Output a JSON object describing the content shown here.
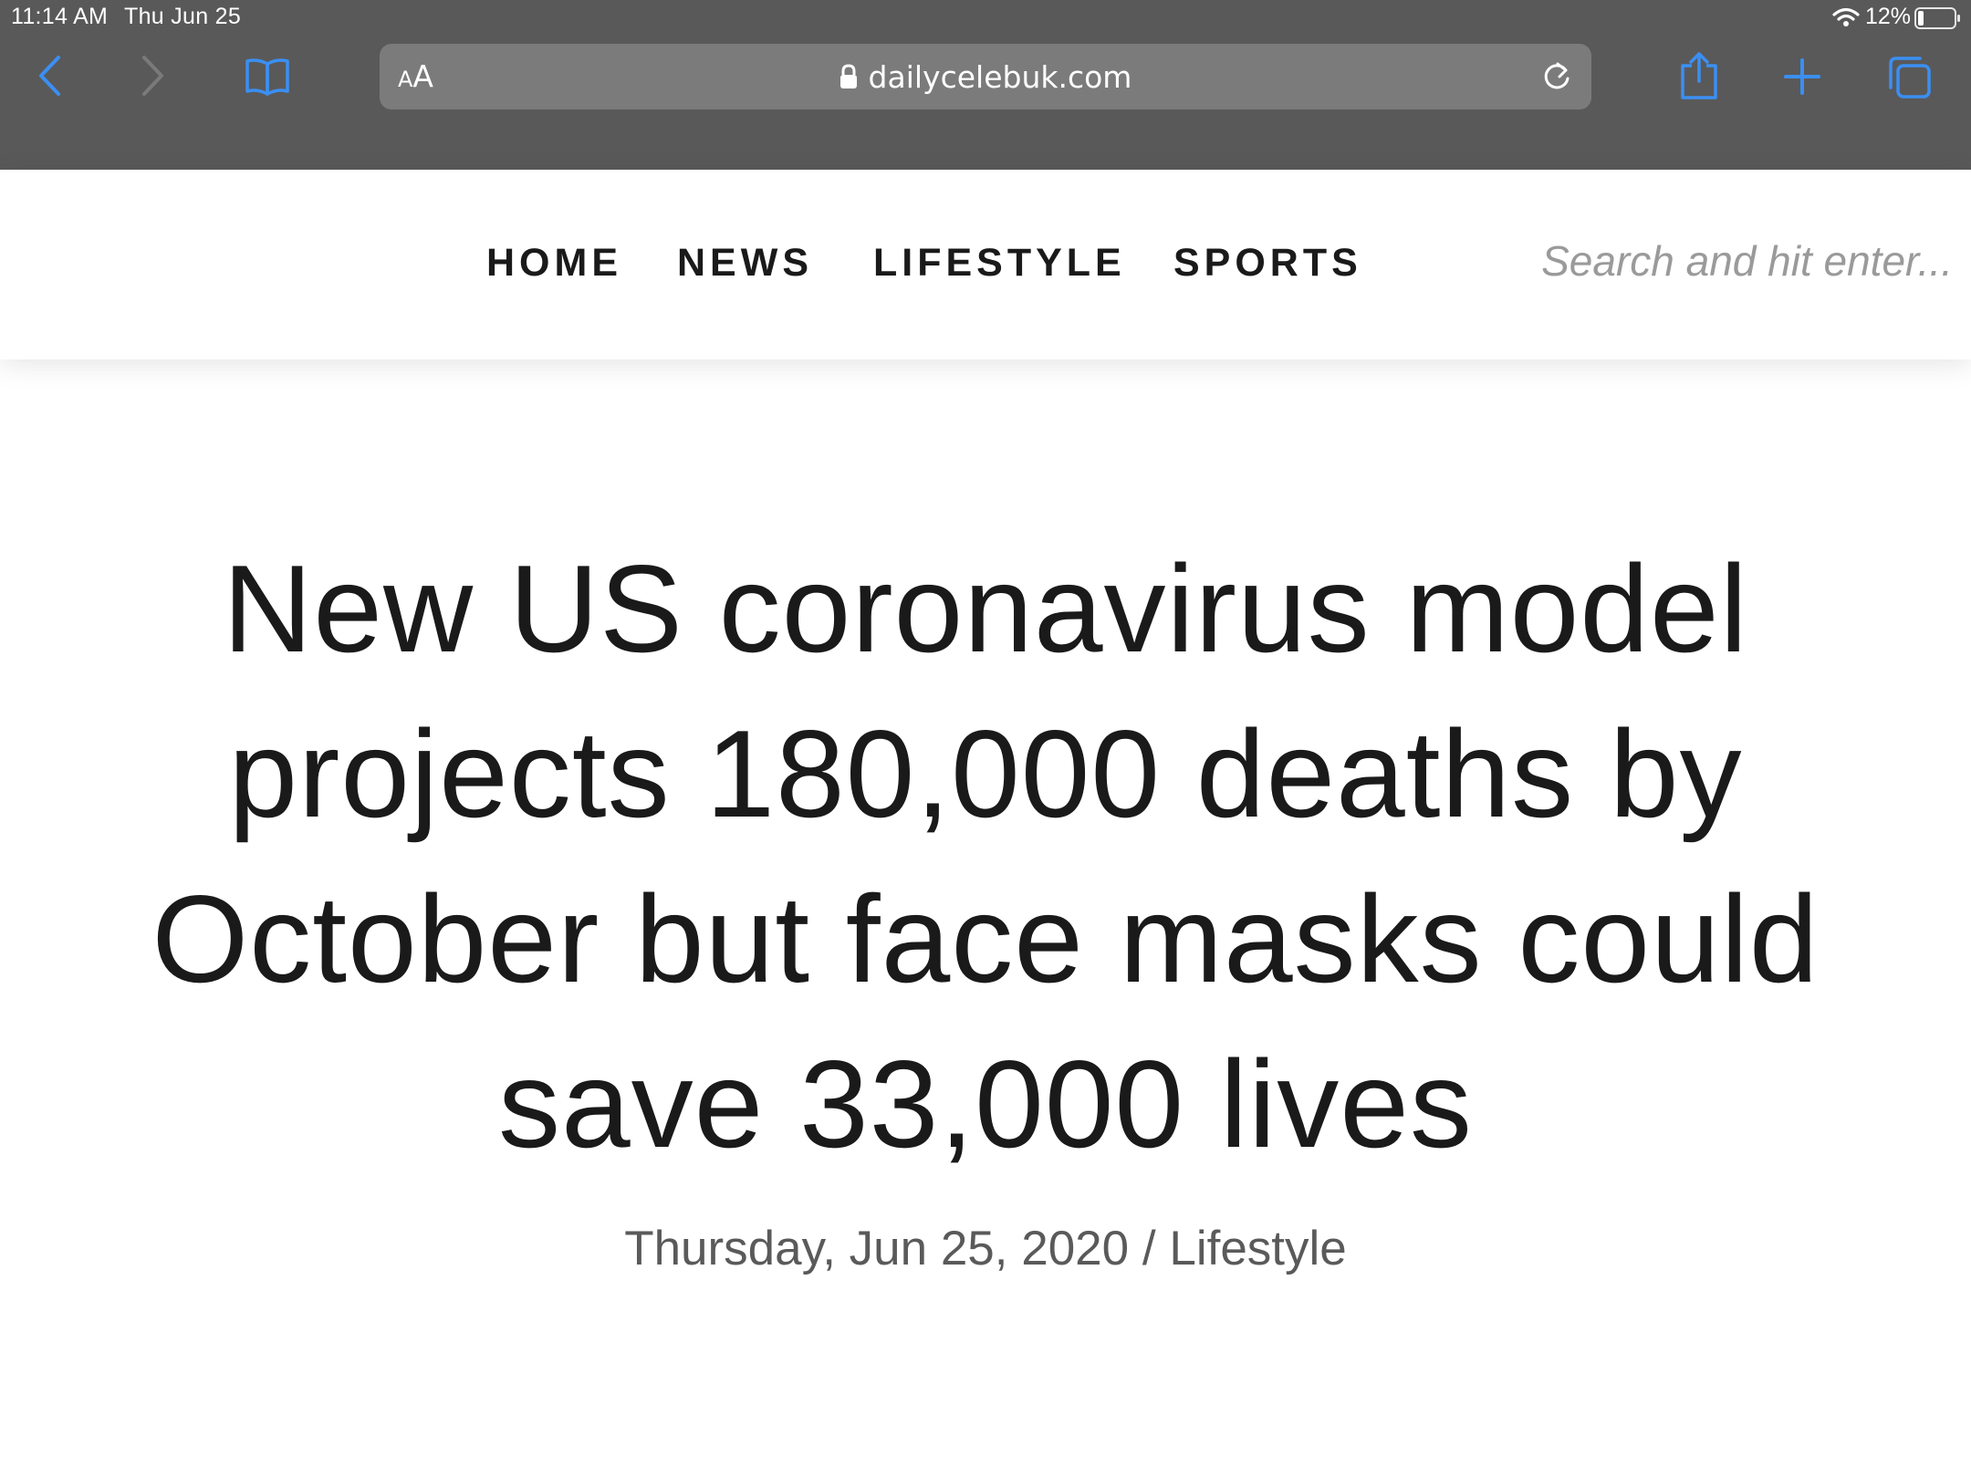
{
  "status_bar": {
    "time": "11:14 AM",
    "date": "Thu Jun 25",
    "battery": "12%"
  },
  "browser": {
    "text_size_label": "AA",
    "url": "dailycelebuk.com",
    "icons": [
      "back-icon",
      "forward-icon",
      "bookmarks-icon",
      "lock-icon",
      "reload-icon",
      "share-icon",
      "new-tab-icon",
      "tabs-icon"
    ],
    "accent_color": "#3b8ff3",
    "chrome_color": "#595959"
  },
  "nav": {
    "items": [
      "HOME",
      "NEWS",
      "LIFESTYLE",
      "SPORTS"
    ],
    "search_placeholder": "Search and hit enter..."
  },
  "article": {
    "title": "New US coronavirus model projects 180,000 deaths by October but face masks could save 33,000 lives",
    "date": "Thursday, Jun 25, 2020",
    "separator": "/",
    "category": "Lifestyle"
  }
}
